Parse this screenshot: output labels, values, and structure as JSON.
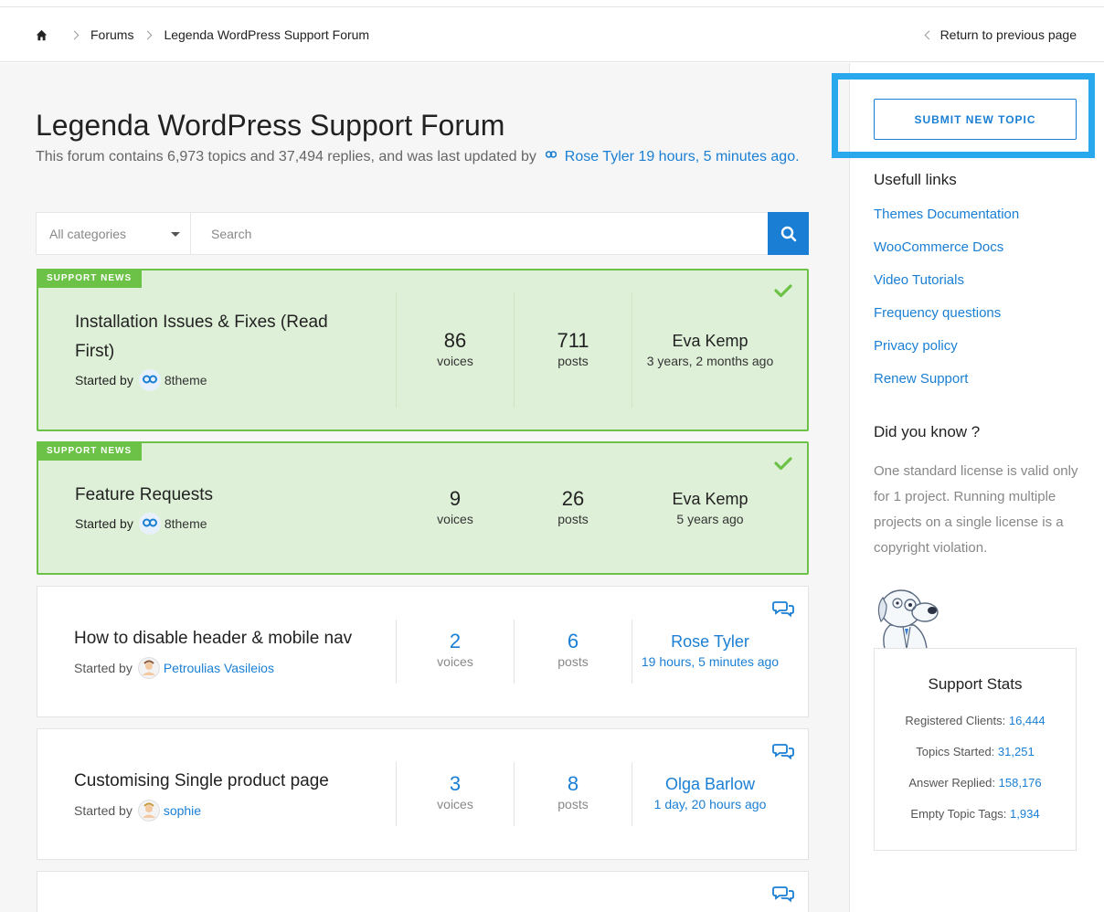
{
  "breadcrumb": {
    "home_icon": "home-icon",
    "items": [
      "Forums",
      "Legenda WordPress Support Forum"
    ],
    "return_label": "Return to previous page"
  },
  "header": {
    "title": "Legenda WordPress Support Forum",
    "desc_prefix": "This forum contains 6,973 topics and 37,494 replies, and was last updated by",
    "desc_user": "Rose Tyler",
    "desc_time": "19 hours, 5 minutes ago",
    "desc_suffix": "."
  },
  "search": {
    "category_selected": "All categories",
    "placeholder": "Search",
    "button_icon": "search-icon"
  },
  "topics": [
    {
      "badge": "SUPPORT NEWS",
      "title": "Installation Issues & Fixes (Read First)",
      "started_by_label": "Started by",
      "author": "8theme",
      "voices": "86",
      "voices_label": "voices",
      "posts": "711",
      "posts_label": "posts",
      "last_user": "Eva Kemp",
      "last_time": "3 years, 2 months ago",
      "status_icon": "check-icon"
    },
    {
      "badge": "SUPPORT NEWS",
      "title": "Feature Requests",
      "started_by_label": "Started by",
      "author": "8theme",
      "voices": "9",
      "voices_label": "voices",
      "posts": "26",
      "posts_label": "posts",
      "last_user": "Eva Kemp",
      "last_time": "5 years ago",
      "status_icon": "check-icon"
    },
    {
      "title": "How to disable header & mobile nav",
      "started_by_label": "Started by",
      "author": "Petroulias Vasileios",
      "voices": "2",
      "voices_label": "voices",
      "posts": "6",
      "posts_label": "posts",
      "last_user": "Rose Tyler",
      "last_time": "19 hours, 5 minutes ago",
      "status_icon": "chat-bubbles-icon"
    },
    {
      "title": "Customising Single product page",
      "started_by_label": "Started by",
      "author": "sophie",
      "voices": "3",
      "voices_label": "voices",
      "posts": "8",
      "posts_label": "posts",
      "last_user": "Olga Barlow",
      "last_time": "1 day, 20 hours ago",
      "status_icon": "chat-bubbles-icon"
    }
  ],
  "sidebar": {
    "submit_label": "SUBMIT NEW TOPIC",
    "links_title": "Usefull links",
    "links": [
      "Themes Documentation",
      "WooCommerce Docs",
      "Video Tutorials",
      "Frequency questions",
      "Privacy policy",
      "Renew Support"
    ],
    "know_title": "Did you know ?",
    "know_text": "One standard license is valid only for 1 project. Running multiple projects on a single license is a copyright violation.",
    "stats_title": "Support Stats",
    "stats": [
      {
        "label": "Registered Clients:",
        "value": "16,444"
      },
      {
        "label": "Topics Started:",
        "value": "31,251"
      },
      {
        "label": "Answer Replied:",
        "value": "158,176"
      },
      {
        "label": "Empty Topic Tags:",
        "value": "1,934"
      }
    ]
  },
  "colors": {
    "accent": "#1a7fd4",
    "highlight_frame": "#29a8ee",
    "news_bg": "#dff0d8",
    "news_border": "#6cc247"
  }
}
